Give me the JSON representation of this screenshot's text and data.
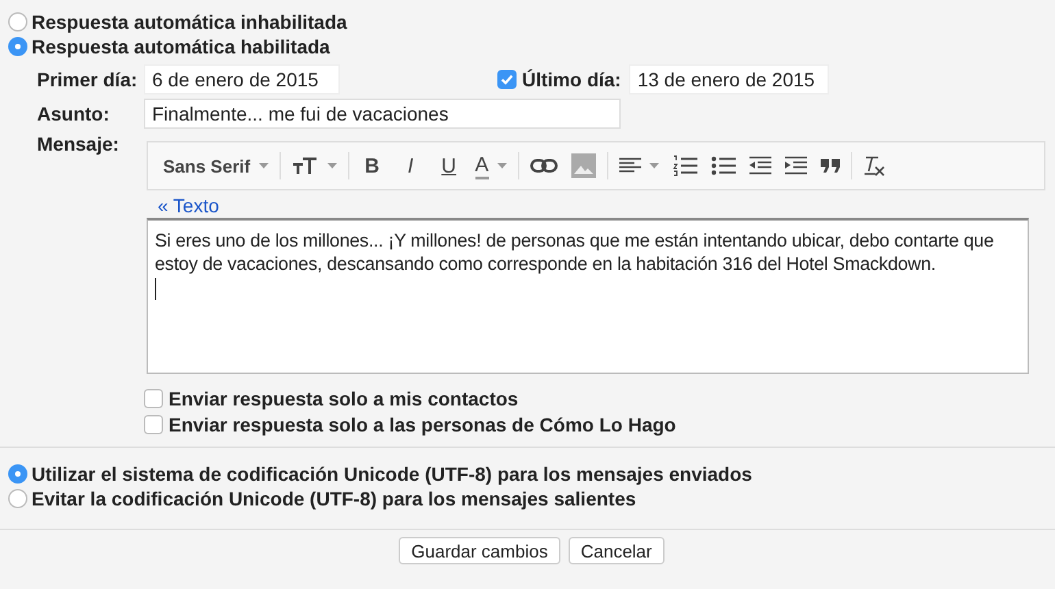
{
  "autoreply": [
    {
      "label": "Respuesta automática inhabilitada",
      "selected": false
    },
    {
      "label": "Respuesta automática habilitada",
      "selected": true
    }
  ],
  "first_day": {
    "label": "Primer día:",
    "value": "6 de enero de 2015"
  },
  "last_day": {
    "label": "Último día:",
    "checked": true,
    "value": "13 de enero de 2015"
  },
  "subject": {
    "label": "Asunto:",
    "value": "Finalmente... me fui de vacaciones"
  },
  "message": {
    "label": "Mensaje:",
    "toolbar": [
      {
        "kind": "font",
        "label": "Sans Serif"
      },
      {
        "kind": "size"
      },
      {
        "kind": "bold",
        "label": "B"
      },
      {
        "kind": "italic",
        "label": "I"
      },
      {
        "kind": "underline",
        "label": "U"
      },
      {
        "kind": "color",
        "label": "A"
      },
      {
        "kind": "link"
      },
      {
        "kind": "image"
      },
      {
        "kind": "align"
      },
      {
        "kind": "numbered"
      },
      {
        "kind": "bulleted"
      },
      {
        "kind": "outdent"
      },
      {
        "kind": "indent"
      },
      {
        "kind": "quote"
      },
      {
        "kind": "clear"
      }
    ],
    "plain_text_link": "«  Texto",
    "body": "Si eres uno de los millones... ¡Y millones! de personas que me están intentando ubicar, debo contarte que estoy de vacaciones, descansando como corresponde en la habitación 316 del Hotel Smackdown."
  },
  "restrictions": [
    {
      "label": "Enviar respuesta solo a mis contactos",
      "checked": false
    },
    {
      "label": "Enviar respuesta solo a las personas de Cómo Lo Hago",
      "checked": false
    }
  ],
  "encoding": [
    {
      "label": "Utilizar el sistema de codificación Unicode (UTF-8) para los mensajes enviados",
      "selected": true
    },
    {
      "label": "Evitar la codificación Unicode (UTF-8) para los mensajes salientes",
      "selected": false
    }
  ],
  "buttons": [
    "Guardar cambios",
    "Cancelar"
  ]
}
